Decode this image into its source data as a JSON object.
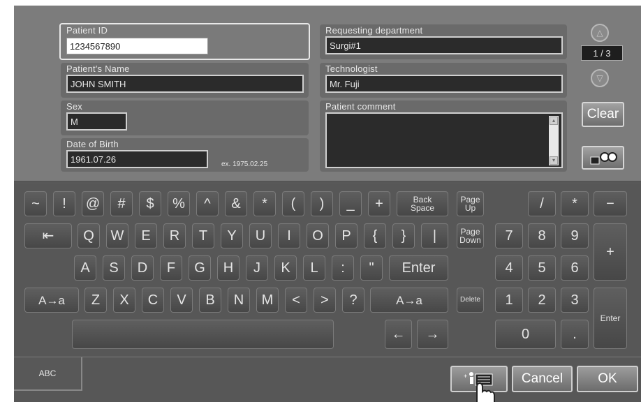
{
  "fields": {
    "patient_id": {
      "label": "Patient ID",
      "value": "1234567890"
    },
    "patient_name": {
      "label": "Patient's Name",
      "value": "JOHN SMITH"
    },
    "sex": {
      "label": "Sex",
      "value": "M"
    },
    "dob": {
      "label": "Date of Birth",
      "value": "1961.07.26",
      "hint": "ex. 1975.02.25"
    },
    "department": {
      "label": "Requesting department",
      "value": "Surgi#1"
    },
    "technologist": {
      "label": "Technologist",
      "value": "Mr. Fuji"
    },
    "comment": {
      "label": "Patient comment",
      "value": ""
    }
  },
  "pager": {
    "up_icon": "△",
    "text": "1 / 3",
    "down_icon": "▽"
  },
  "side": {
    "clear": "Clear",
    "binocular_icon": "binoculars-icon"
  },
  "keys": {
    "row1": [
      "~",
      "!",
      "@",
      "#",
      "$",
      "%",
      "^",
      "&",
      "*",
      "(",
      ")",
      "_",
      "+"
    ],
    "backspace": "Back\nSpace",
    "pageup": "Page\nUp",
    "pagedown": "Page\nDown",
    "tab": "⇤",
    "row2": [
      "Q",
      "W",
      "E",
      "R",
      "T",
      "Y",
      "U",
      "I",
      "O",
      "P",
      "{",
      "}",
      "|"
    ],
    "row3": [
      "A",
      "S",
      "D",
      "F",
      "G",
      "H",
      "J",
      "K",
      "L",
      ":",
      "\""
    ],
    "enter": "Enter",
    "shift": "A→a",
    "row4": [
      "Z",
      "X",
      "C",
      "V",
      "B",
      "N",
      "M",
      "<",
      ">",
      "?"
    ],
    "delete": "Delete",
    "left": "←",
    "right": "→",
    "numpad_ops": [
      "/",
      "*",
      "−"
    ],
    "numpad": [
      "7",
      "8",
      "9",
      "4",
      "5",
      "6",
      "1",
      "2",
      "3"
    ],
    "plus": "+",
    "zero": "0",
    "dot": ".",
    "numenter": "Enter"
  },
  "bottom": {
    "tab_label": "ABC",
    "cancel": "Cancel",
    "ok": "OK",
    "id_icon": "patient-id-card-icon"
  }
}
